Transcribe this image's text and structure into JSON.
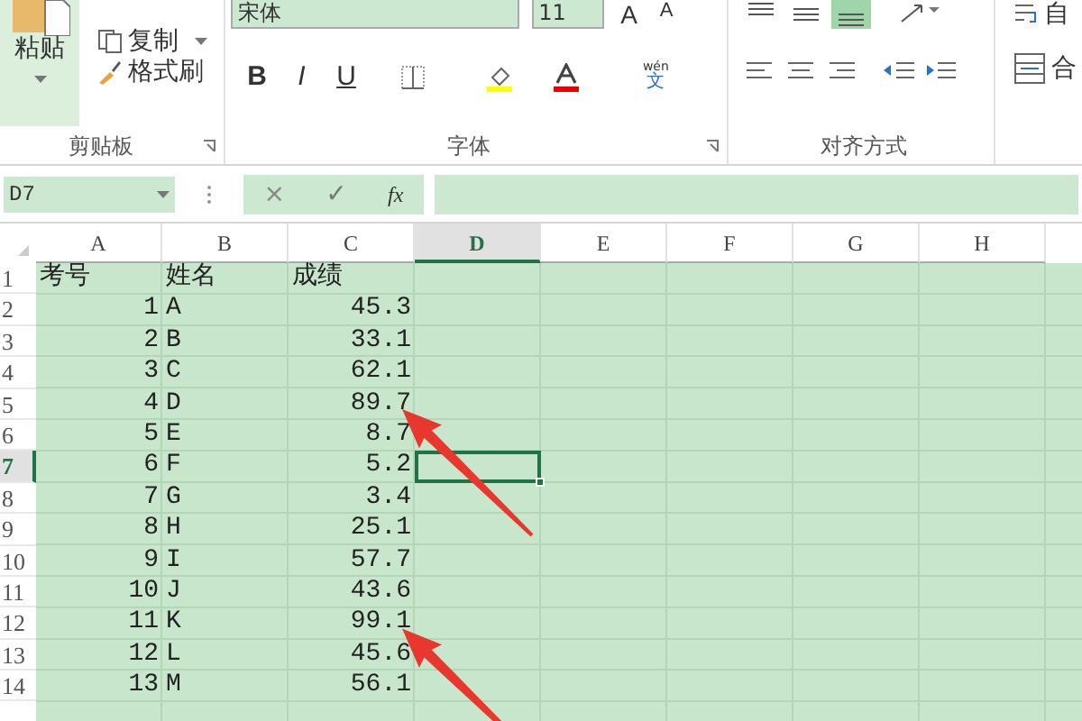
{
  "ribbon": {
    "clipboard": {
      "paste": "粘贴",
      "paste_dropdown": true,
      "items": [
        {
          "label": "复制",
          "kind": "copy",
          "dropdown": true
        },
        {
          "label": "格式刷",
          "kind": "brush",
          "dropdown": false
        }
      ],
      "label": "剪贴板"
    },
    "font": {
      "font_name": "宋体",
      "font_size": "11",
      "style_buttons": [
        {
          "label": "B",
          "kind": "bold"
        },
        {
          "label": "I",
          "kind": "italic"
        },
        {
          "label": "U",
          "kind": "underline"
        }
      ],
      "size_buttons": [
        {
          "label": "A",
          "kind": "grow"
        },
        {
          "label": "A",
          "kind": "shrink"
        }
      ],
      "phonetic": {
        "top": "wén",
        "bottom": "文"
      },
      "label": "字体"
    },
    "alignment": {
      "label": "对齐方式",
      "top_buttons": [
        {
          "kind": "top",
          "selected": false
        },
        {
          "kind": "middle",
          "selected": false
        },
        {
          "kind": "bottom",
          "selected": true
        }
      ]
    },
    "wrap_text": "自",
    "merge": "合"
  },
  "formula_bar": {
    "name_box": "D7",
    "cancel": "×",
    "enter": "✓",
    "fx": "fx"
  },
  "sheet": {
    "columns": [
      {
        "label": "A",
        "selected": false
      },
      {
        "label": "B",
        "selected": false
      },
      {
        "label": "C",
        "selected": false
      },
      {
        "label": "D",
        "selected": true
      },
      {
        "label": "E",
        "selected": false
      },
      {
        "label": "F",
        "selected": false
      },
      {
        "label": "G",
        "selected": false
      },
      {
        "label": "H",
        "selected": false
      }
    ],
    "rows": [
      {
        "header": "1",
        "kind": "heading",
        "selected": false,
        "arrow": false,
        "cells": [
          "考号",
          "姓名",
          "成绩"
        ]
      },
      {
        "header": "2",
        "kind": "data",
        "selected": false,
        "arrow": false,
        "cells": [
          "1",
          "A",
          "45.3"
        ]
      },
      {
        "header": "3",
        "kind": "data",
        "selected": false,
        "arrow": false,
        "cells": [
          "2",
          "B",
          "33.1"
        ]
      },
      {
        "header": "4",
        "kind": "data",
        "selected": false,
        "arrow": false,
        "cells": [
          "3",
          "C",
          "62.1"
        ]
      },
      {
        "header": "5",
        "kind": "data",
        "selected": false,
        "arrow": true,
        "cells": [
          "4",
          "D",
          "89.7"
        ]
      },
      {
        "header": "6",
        "kind": "data",
        "selected": false,
        "arrow": false,
        "cells": [
          "5",
          "E",
          "8.7"
        ]
      },
      {
        "header": "7",
        "kind": "data",
        "selected": true,
        "arrow": false,
        "cells": [
          "6",
          "F",
          "5.2"
        ]
      },
      {
        "header": "8",
        "kind": "data",
        "selected": false,
        "arrow": false,
        "cells": [
          "7",
          "G",
          "3.4"
        ]
      },
      {
        "header": "9",
        "kind": "data",
        "selected": false,
        "arrow": false,
        "cells": [
          "8",
          "H",
          "25.1"
        ]
      },
      {
        "header": "10",
        "kind": "data",
        "selected": false,
        "arrow": false,
        "cells": [
          "9",
          "I",
          "57.7"
        ]
      },
      {
        "header": "11",
        "kind": "data",
        "selected": false,
        "arrow": false,
        "cells": [
          "10",
          "J",
          "43.6"
        ]
      },
      {
        "header": "12",
        "kind": "data",
        "selected": false,
        "arrow": true,
        "cells": [
          "11",
          "K",
          "99.1"
        ]
      },
      {
        "header": "13",
        "kind": "data",
        "selected": false,
        "arrow": false,
        "cells": [
          "12",
          "L",
          "45.6"
        ]
      },
      {
        "header": "14",
        "kind": "data",
        "selected": false,
        "arrow": false,
        "cells": [
          "13",
          "M",
          "56.1"
        ]
      }
    ]
  }
}
